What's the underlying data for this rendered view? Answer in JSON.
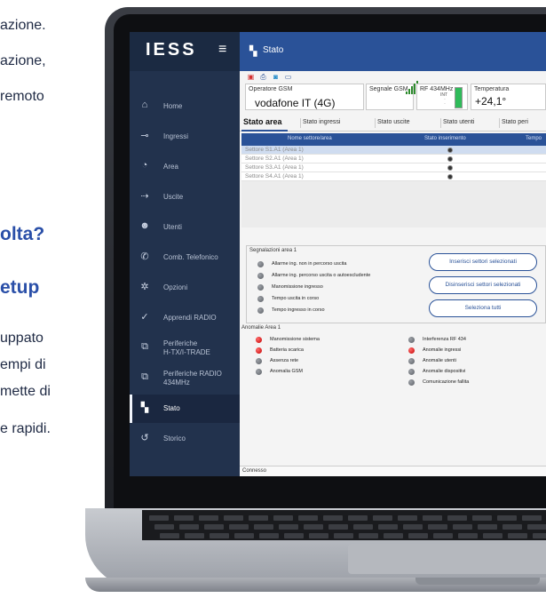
{
  "marketing": {
    "line1": "azione.",
    "line2": "azione,",
    "line3": "remoto",
    "heading1": "olta?",
    "heading2": "etup",
    "body1": "uppato",
    "body2": "empi di",
    "body3": "mette di",
    "body4": "e rapidi."
  },
  "app": {
    "logo": "IESS",
    "menu_icon": "hamburger-icon",
    "header_title": "Stato",
    "sidebar": [
      {
        "label": "Home",
        "icon": "home-icon"
      },
      {
        "label": "Ingressi",
        "icon": "input-icon"
      },
      {
        "label": "Area",
        "icon": "pie-icon"
      },
      {
        "label": "Uscite",
        "icon": "output-icon"
      },
      {
        "label": "Utenti",
        "icon": "users-icon"
      },
      {
        "label": "Comb. Telefonico",
        "icon": "phone-icon"
      },
      {
        "label": "Opzioni",
        "icon": "gear-icon"
      },
      {
        "label": "Apprendi RADIO",
        "icon": "check-icon"
      },
      {
        "label": "Periferiche H-TX/I-TRADE",
        "line1": "Periferiche",
        "line2": "H-TX/I-TRADE",
        "icon": "network-icon"
      },
      {
        "label": "Periferiche RADIO 434MHz",
        "line1": "Periferiche RADIO",
        "line2": "434MHz",
        "icon": "network-icon"
      },
      {
        "label": "Stato",
        "icon": "stato-icon",
        "active": true
      },
      {
        "label": "Storico",
        "icon": "history-icon"
      }
    ],
    "toolbar_icons": [
      "save-icon",
      "print-icon",
      "camera-icon",
      "window-icon"
    ],
    "info": {
      "operator_label": "Operatore GSM",
      "operator_value": "vodafone IT (4G)",
      "signal_label": "Segnale GSM",
      "signal_level": 5,
      "rf_label": "RF 434MHz",
      "rf_int": "INT",
      "temp_label": "Temperatura",
      "temp_value": "+24,1°"
    },
    "tabs": [
      "Stato area",
      "Stato ingressi",
      "Stato uscite",
      "Stato utenti",
      "Stato peri"
    ],
    "table": {
      "headers": [
        "Nome settore/area",
        "Stato inserimento",
        "Tempo"
      ],
      "rows": [
        {
          "name": "Settore S1.A1 (Area 1)",
          "selected": true
        },
        {
          "name": "Settore S2.A1 (Area 1)",
          "selected": false
        },
        {
          "name": "Settore S3.A1 (Area 1)",
          "selected": false
        },
        {
          "name": "Settore S4.A1 (Area 1)",
          "selected": false
        }
      ]
    },
    "signals": {
      "title": "Segnalazioni area 1",
      "items": [
        "Allarme ing. non in percorso uscita",
        "Allarme ing. percorso uscita o autoescludente",
        "Manomissione ingresso",
        "Tempo uscita in corso",
        "Tempo ingresso in corso"
      ]
    },
    "buttons": {
      "insert": "Inserisci settori selezionati",
      "disinsert": "Disinserisci settori selezionati",
      "select_all": "Seleziona tutti"
    },
    "anomalies": {
      "title": "Anomalie Area 1",
      "left": [
        {
          "label": "Manomissione sistema",
          "red": true
        },
        {
          "label": "Batteria scarica",
          "red": true
        },
        {
          "label": "Assenza rete",
          "red": false
        },
        {
          "label": "Anomalia GSM",
          "red": false
        }
      ],
      "right": [
        {
          "label": "Interferenza RF 434",
          "red": false
        },
        {
          "label": "Anomalie ingressi",
          "red": true
        },
        {
          "label": "Anomalie utenti",
          "red": false
        },
        {
          "label": "Anomalie dispositivi",
          "red": false
        },
        {
          "label": "Comunicazione fallita",
          "red": false
        }
      ]
    },
    "status_bar": "Connesso"
  }
}
